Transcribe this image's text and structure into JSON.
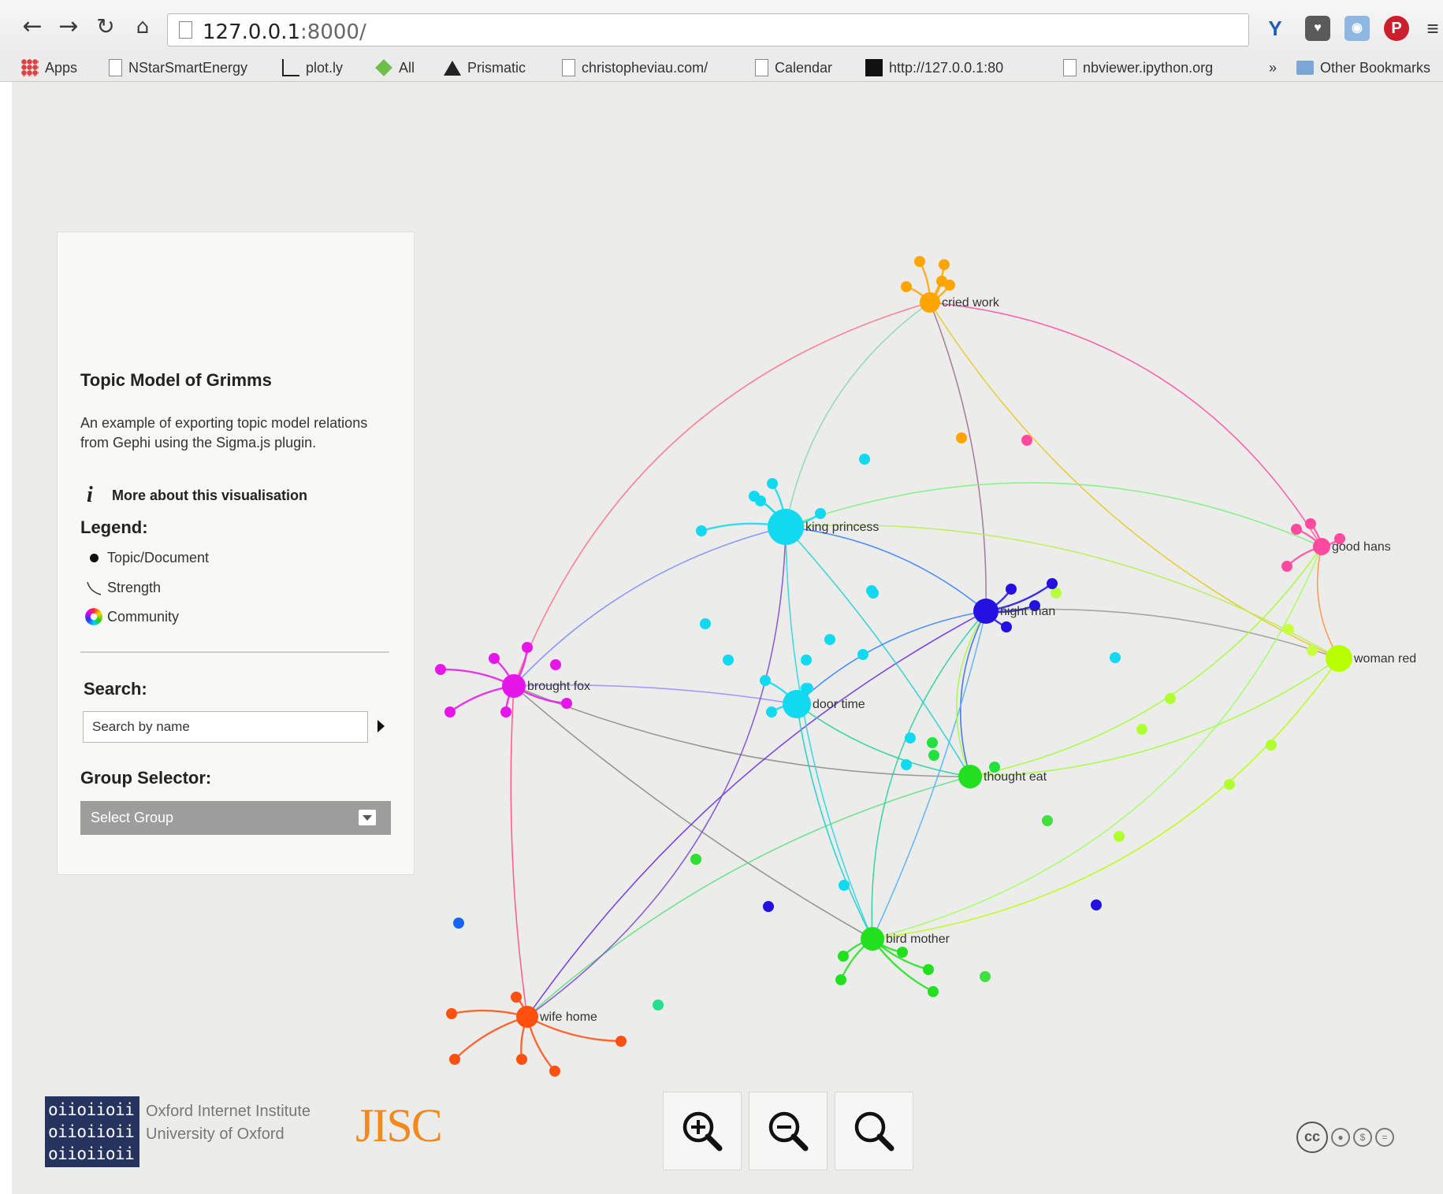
{
  "browser": {
    "url_host": "127.0.0.1",
    "url_rest": ":8000/",
    "bookmarks": [
      {
        "label": "Apps",
        "icon": "apps-grid-icon"
      },
      {
        "label": "NStarSmartEnergy",
        "icon": "page-icon"
      },
      {
        "label": "plot.ly",
        "icon": "chart-icon"
      },
      {
        "label": "All",
        "icon": "feedly-icon"
      },
      {
        "label": "Prismatic",
        "icon": "triangle-icon"
      },
      {
        "label": "christopheviau.com/",
        "icon": "page-icon"
      },
      {
        "label": "Calendar",
        "icon": "page-icon"
      },
      {
        "label": "http://127.0.0.1:80",
        "icon": "black-square-icon"
      },
      {
        "label": "nbviewer.ipython.org",
        "icon": "nb-icon"
      },
      {
        "label": "»",
        "icon": "chevron-icon"
      },
      {
        "label": "Other Bookmarks",
        "icon": "folder-icon"
      }
    ]
  },
  "panel": {
    "title": "Topic Model of Grimms",
    "description": "An example of exporting topic model relations from Gephi using the Sigma.js plugin.",
    "more_link": "More about this visualisation",
    "legend_title": "Legend:",
    "legend": {
      "node": "Topic/Document",
      "edge": "Strength",
      "color": "Community"
    },
    "search_title": "Search:",
    "search_placeholder": "Search by name",
    "group_title": "Group Selector:",
    "group_value": "Select Group"
  },
  "graph": {
    "node_labels": {
      "cried_work": "cried work",
      "king_princess": "king princess",
      "good_hans": "good hans",
      "night_man": "night man",
      "woman_red": "woman red",
      "brought_fox": "brought fox",
      "door_time": "door time",
      "thought_eat": "thought eat",
      "bird_mother": "bird mother",
      "wife_home": "wife home"
    },
    "colors": {
      "orange": "#ffa500",
      "cyan": "#11d9f0",
      "pink": "#ff4aa0",
      "blue": "#2211e0",
      "lime": "#b8ff00",
      "magenta": "#e616e8",
      "green": "#22e020",
      "red_orange": "#ff5010",
      "isolated": "#1466f5"
    }
  },
  "footer": {
    "oii_logo": "oiioiioii oiioiioii oiioiioii",
    "oii_line1": "Oxford Internet Institute",
    "oii_line2": "University of Oxford",
    "jisc": "JISC",
    "cc": "cc"
  },
  "zoom": {
    "in": "zoom-in",
    "out": "zoom-out",
    "reset": "zoom-reset"
  }
}
